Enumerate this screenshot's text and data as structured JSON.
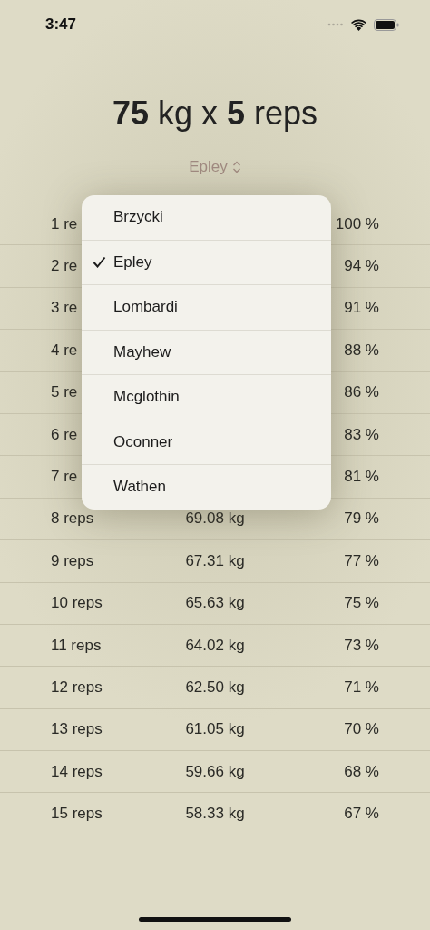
{
  "status_bar": {
    "time": "3:47"
  },
  "title": {
    "weight": "75",
    "weight_unit": "kg x",
    "reps": "5",
    "reps_unit": "reps"
  },
  "formula_picker": {
    "label": "Epley"
  },
  "menu": [
    {
      "label": "Brzycki",
      "selected": false
    },
    {
      "label": "Epley",
      "selected": true
    },
    {
      "label": "Lombardi",
      "selected": false
    },
    {
      "label": "Mayhew",
      "selected": false
    },
    {
      "label": "Mcglothin",
      "selected": false
    },
    {
      "label": "Oconner",
      "selected": false
    },
    {
      "label": "Wathen",
      "selected": false
    }
  ],
  "rows": [
    {
      "reps": "1 re",
      "percent": "100 %"
    },
    {
      "reps": "2 re",
      "percent": "94 %"
    },
    {
      "reps": "3 re",
      "percent": "91 %"
    },
    {
      "reps": "4 re",
      "percent": "88 %"
    },
    {
      "reps": "5 re",
      "percent": "86 %"
    },
    {
      "reps": "6 re",
      "percent": "83 %"
    },
    {
      "reps": "7 re",
      "percent": "81 %"
    },
    {
      "reps": "8 reps",
      "weight": "69.08 kg",
      "percent": "79 %"
    },
    {
      "reps": "9 reps",
      "weight": "67.31 kg",
      "percent": "77 %"
    },
    {
      "reps": "10 reps",
      "weight": "65.63 kg",
      "percent": "75 %"
    },
    {
      "reps": "11 reps",
      "weight": "64.02 kg",
      "percent": "73 %"
    },
    {
      "reps": "12 reps",
      "weight": "62.50 kg",
      "percent": "71 %"
    },
    {
      "reps": "13 reps",
      "weight": "61.05 kg",
      "percent": "70 %"
    },
    {
      "reps": "14 reps",
      "weight": "59.66 kg",
      "percent": "68 %"
    },
    {
      "reps": "15 reps",
      "weight": "58.33 kg",
      "percent": "67 %"
    }
  ]
}
